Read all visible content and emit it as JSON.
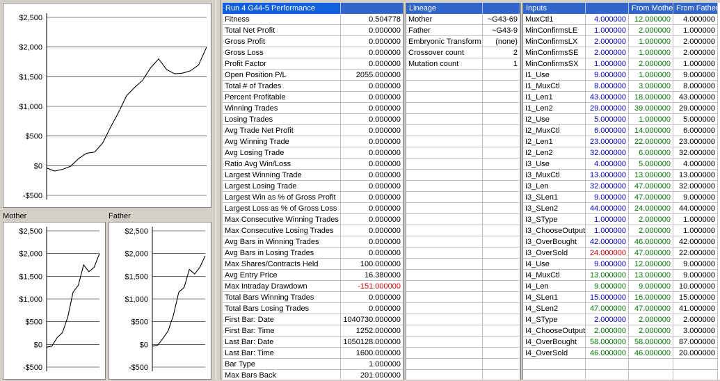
{
  "charts": {
    "main": {
      "y_ticks": [
        "$2,500",
        "$2,000",
        "$1,500",
        "$1,000",
        "$500",
        "$0",
        "-$500"
      ]
    },
    "mother": {
      "title": "Mother",
      "y_ticks": [
        "$2,500",
        "$2,000",
        "$1,500",
        "$1,000",
        "$500",
        "$0",
        "-$500"
      ]
    },
    "father": {
      "title": "Father",
      "y_ticks": [
        "$2,500",
        "$2,000",
        "$1,500",
        "$1,000",
        "$500",
        "$0",
        "-$500"
      ]
    }
  },
  "chart_data": [
    {
      "type": "line",
      "ylim": [
        -500,
        2500
      ],
      "x": [
        0,
        5,
        10,
        15,
        20,
        25,
        30,
        35,
        40,
        45,
        50,
        55,
        60,
        65,
        70,
        75,
        80,
        85,
        90,
        95,
        100
      ],
      "values": [
        -40,
        -90,
        -60,
        -10,
        120,
        210,
        230,
        380,
        650,
        900,
        1180,
        1320,
        1440,
        1650,
        1800,
        1620,
        1550,
        1560,
        1600,
        1700,
        2000
      ],
      "series_color": "#000000"
    },
    {
      "type": "line",
      "ylim": [
        -500,
        2500
      ],
      "x": [
        0,
        10,
        20,
        30,
        40,
        50,
        60,
        70,
        80,
        90,
        100
      ],
      "values": [
        -60,
        -40,
        150,
        260,
        600,
        1150,
        1300,
        1750,
        1600,
        1700,
        2000
      ]
    },
    {
      "type": "line",
      "ylim": [
        -500,
        2500
      ],
      "x": [
        0,
        10,
        20,
        30,
        40,
        50,
        60,
        70,
        80,
        90,
        100
      ],
      "values": [
        -40,
        -20,
        130,
        300,
        650,
        1150,
        1250,
        1650,
        1550,
        1700,
        1950
      ]
    }
  ],
  "performance": {
    "header": "Run 4  G44-5 Performance",
    "rows": [
      [
        "Fitness",
        "0.504778"
      ],
      [
        "Total Net Profit",
        "0.000000"
      ],
      [
        "Gross Profit",
        "0.000000"
      ],
      [
        "Gross Loss",
        "0.000000"
      ],
      [
        "Profit Factor",
        "0.000000"
      ],
      [
        "Open Position P/L",
        "2055.000000"
      ],
      [
        "Total # of Trades",
        "0.000000"
      ],
      [
        "Percent Profitable",
        "0.000000"
      ],
      [
        "Winning Trades",
        "0.000000"
      ],
      [
        "Losing Trades",
        "0.000000"
      ],
      [
        "Avg Trade Net Profit",
        "0.000000"
      ],
      [
        "Avg Winning Trade",
        "0.000000"
      ],
      [
        "Avg Losing Trade",
        "0.000000"
      ],
      [
        "Ratio Avg Win/Loss",
        "0.000000"
      ],
      [
        "Largest Winning Trade",
        "0.000000"
      ],
      [
        "Largest Losing Trade",
        "0.000000"
      ],
      [
        "Largest Win as % of Gross Profit",
        "0.000000"
      ],
      [
        "Largest Loss as % of Gross Loss",
        "0.000000"
      ],
      [
        "Max Consecutive Winning Trades",
        "0.000000"
      ],
      [
        "Max Consecutive Losing Trades",
        "0.000000"
      ],
      [
        "Avg Bars in Winning Trades",
        "0.000000"
      ],
      [
        "Avg Bars in Losing Trades",
        "0.000000"
      ],
      [
        "Max Shares/Contracts Held",
        "100.000000"
      ],
      [
        "Avg Entry Price",
        "16.380000"
      ],
      [
        "Max Intraday Drawdown",
        "-151.000000"
      ],
      [
        "Total Bars Winning Trades",
        "0.000000"
      ],
      [
        "Total Bars Losing Trades",
        "0.000000"
      ],
      [
        "First Bar: Date",
        "1040730.000000"
      ],
      [
        "First Bar: Time",
        "1252.000000"
      ],
      [
        "Last  Bar: Date",
        "1050128.000000"
      ],
      [
        "Last  Bar: Time",
        "1600.000000"
      ],
      [
        "Bar Type",
        "1.000000"
      ],
      [
        "Max Bars Back",
        "201.000000"
      ]
    ]
  },
  "lineage": {
    "header": "Lineage",
    "rows": [
      [
        "Mother",
        "~G43-69"
      ],
      [
        "Father",
        "~G43-9"
      ],
      [
        "Embryonic Transform",
        "(none)"
      ],
      [
        "Crossover count",
        "2"
      ],
      [
        "Mutation count",
        "1"
      ]
    ]
  },
  "inputs": {
    "headers": [
      "Inputs",
      "",
      "From Mother",
      "From Father"
    ],
    "rows": [
      [
        "MuxCtl1",
        "4.000000",
        "12.000000",
        "4.000000"
      ],
      [
        "MinConfirmsLE",
        "1.000000",
        "2.000000",
        "1.000000"
      ],
      [
        "MinConfirmsLX",
        "2.000000",
        "1.000000",
        "2.000000"
      ],
      [
        "MinConfirmsSE",
        "2.000000",
        "1.000000",
        "2.000000"
      ],
      [
        "MinConfirmsSX",
        "1.000000",
        "2.000000",
        "1.000000"
      ],
      [
        "I1_Use",
        "9.000000",
        "1.000000",
        "9.000000"
      ],
      [
        "I1_MuxCtl",
        "8.000000",
        "3.000000",
        "8.000000"
      ],
      [
        "I1_Len1",
        "43.000000",
        "18.000000",
        "43.000000"
      ],
      [
        "I1_Len2",
        "29.000000",
        "39.000000",
        "29.000000"
      ],
      [
        "I2_Use",
        "5.000000",
        "1.000000",
        "5.000000"
      ],
      [
        "I2_MuxCtl",
        "6.000000",
        "14.000000",
        "6.000000"
      ],
      [
        "I2_Len1",
        "23.000000",
        "22.000000",
        "23.000000"
      ],
      [
        "I2_Len2",
        "32.000000",
        "6.000000",
        "32.000000"
      ],
      [
        "I3_Use",
        "4.000000",
        "5.000000",
        "4.000000"
      ],
      [
        "I3_MuxCtl",
        "13.000000",
        "13.000000",
        "13.000000"
      ],
      [
        "I3_Len",
        "32.000000",
        "47.000000",
        "32.000000"
      ],
      [
        "I3_SLen1",
        "9.000000",
        "47.000000",
        "9.000000"
      ],
      [
        "I3_SLen2",
        "44.000000",
        "24.000000",
        "44.000000"
      ],
      [
        "I3_SType",
        "1.000000",
        "2.000000",
        "1.000000"
      ],
      [
        "I3_ChooseOutput",
        "1.000000",
        "2.000000",
        "1.000000"
      ],
      [
        "I3_OverBought",
        "42.000000",
        "46.000000",
        "42.000000"
      ],
      [
        "I3_OverSold",
        "24.000000",
        "47.000000",
        "22.000000"
      ],
      [
        "I4_Use",
        "9.000000",
        "12.000000",
        "9.000000"
      ],
      [
        "I4_MuxCtl",
        "13.000000",
        "13.000000",
        "9.000000"
      ],
      [
        "I4_Len",
        "9.000000",
        "9.000000",
        "10.000000"
      ],
      [
        "I4_SLen1",
        "15.000000",
        "16.000000",
        "15.000000"
      ],
      [
        "I4_SLen2",
        "47.000000",
        "47.000000",
        "41.000000"
      ],
      [
        "I4_SType",
        "2.000000",
        "2.000000",
        "2.000000"
      ],
      [
        "I4_ChooseOutput",
        "2.000000",
        "2.000000",
        "3.000000"
      ],
      [
        "I4_OverBought",
        "58.000000",
        "58.000000",
        "87.000000"
      ],
      [
        "I4_OverSold",
        "46.000000",
        "46.000000",
        "20.000000"
      ]
    ],
    "value_colors": [
      "blue",
      "blue",
      "blue",
      "blue",
      "blue",
      "blue",
      "blue",
      "blue",
      "blue",
      "blue",
      "blue",
      "blue",
      "blue",
      "blue",
      "blue",
      "blue",
      "blue",
      "blue",
      "blue",
      "blue",
      "blue",
      "red",
      "blue",
      "green",
      "green",
      "blue",
      "green",
      "blue",
      "green",
      "green",
      "green"
    ]
  }
}
